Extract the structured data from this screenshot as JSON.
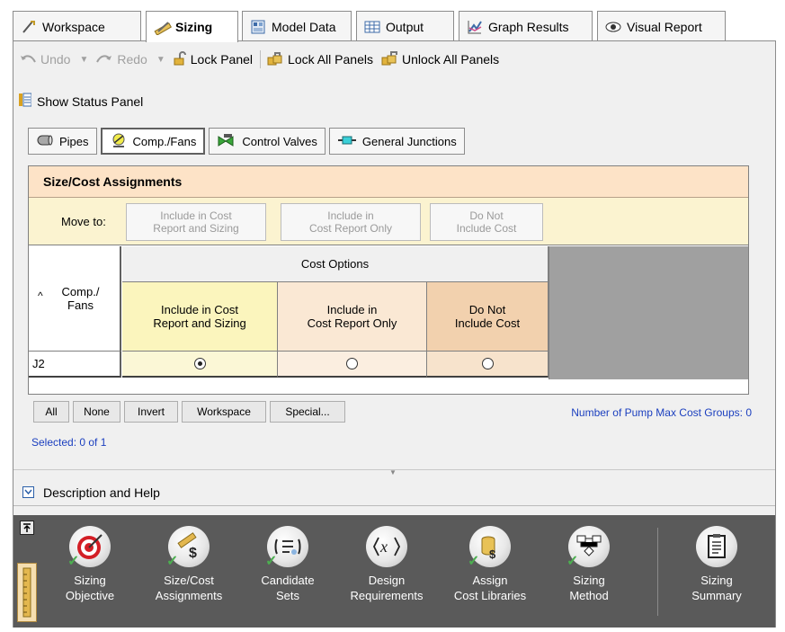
{
  "tabs": [
    {
      "label": "Workspace",
      "icon": "workspace-icon"
    },
    {
      "label": "Sizing",
      "icon": "ruler-pencil-icon",
      "active": true
    },
    {
      "label": "Model Data",
      "icon": "model-data-icon"
    },
    {
      "label": "Output",
      "icon": "table-icon"
    },
    {
      "label": "Graph Results",
      "icon": "graph-icon"
    },
    {
      "label": "Visual Report",
      "icon": "eye-icon"
    }
  ],
  "toolbar": {
    "undo": "Undo",
    "redo": "Redo",
    "lock_panel": "Lock Panel",
    "lock_all": "Lock All Panels",
    "unlock_all": "Unlock All Panels"
  },
  "status_panel": "Show Status Panel",
  "subtabs": [
    {
      "label": "Pipes",
      "icon": "pipe-icon"
    },
    {
      "label": "Comp./Fans",
      "icon": "fan-icon",
      "active": true
    },
    {
      "label": "Control Valves",
      "icon": "valve-icon"
    },
    {
      "label": "General Junctions",
      "icon": "junction-icon"
    }
  ],
  "panel": {
    "title": "Size/Cost Assignments",
    "move_to_label": "Move to:",
    "move_buttons": [
      "Include in Cost\nReport and Sizing",
      "Include in\nCost Report Only",
      "Do Not\nInclude Cost"
    ]
  },
  "grid": {
    "left_header": "Comp./\nFans",
    "group_header": "Cost Options",
    "columns": [
      "Include in Cost\nReport and Sizing",
      "Include in\nCost Report Only",
      "Do Not\nInclude Cost"
    ],
    "rows": [
      {
        "name": "J2",
        "selected_option": 0
      }
    ]
  },
  "selection_buttons": [
    "All",
    "None",
    "Invert",
    "Workspace",
    "Special..."
  ],
  "pump_groups": "Number of Pump Max Cost Groups: 0",
  "selected_count": "Selected: 0 of 1",
  "description_help": "Description and Help",
  "ribbon": [
    {
      "line1": "Sizing",
      "line2": "Objective",
      "icon": "target-icon"
    },
    {
      "line1": "Size/Cost",
      "line2": "Assignments",
      "icon": "ruler-dollar-icon"
    },
    {
      "line1": "Candidate",
      "line2": "Sets",
      "icon": "list-sets-icon"
    },
    {
      "line1": "Design",
      "line2": "Requirements",
      "icon": "variable-x-icon"
    },
    {
      "line1": "Assign",
      "line2": "Cost Libraries",
      "icon": "cost-library-icon"
    },
    {
      "line1": "Sizing",
      "line2": "Method",
      "icon": "flowchart-icon"
    },
    {
      "line1": "Sizing",
      "line2": "Summary",
      "icon": "clipboard-icon"
    }
  ],
  "colors": {
    "title_bar": "#fde3c7",
    "move_bar": "#fbf3d0",
    "link_blue": "#1b3fbf",
    "ribbon_bg": "#5a5a5a"
  }
}
